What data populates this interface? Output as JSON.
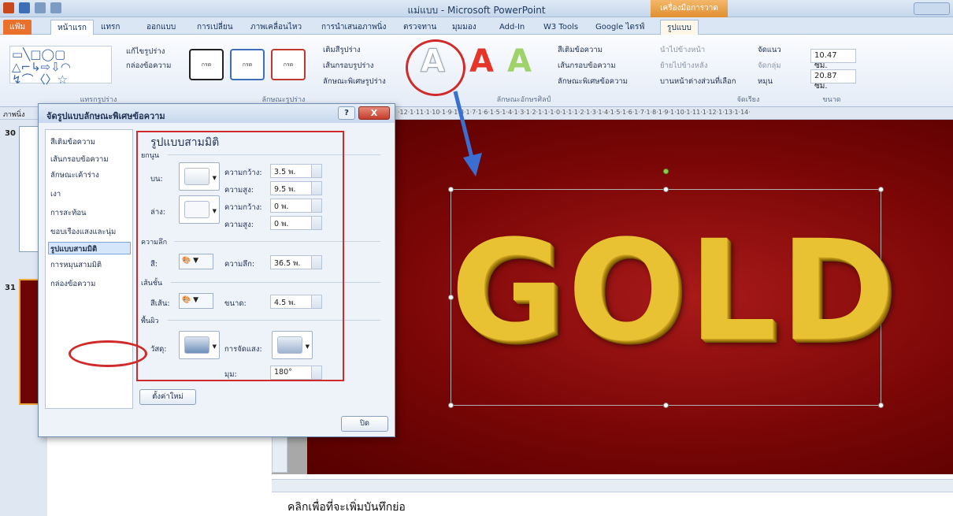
{
  "window": {
    "title": "แม่แบบ - Microsoft PowerPoint",
    "context_tab_group": "เครื่องมือการวาด"
  },
  "tabs": [
    "แฟ้ม",
    "หน้าแรก",
    "แทรก",
    "ออกแบบ",
    "การเปลี่ยน",
    "ภาพเคลื่อนไหว",
    "การนำเสนอภาพนิ่ง",
    "ตรวจทาน",
    "มุมมอง",
    "Add-In",
    "W3 Tools",
    "Google ไดรฟ์",
    "รูปแบบ"
  ],
  "ribbon": {
    "insert_shapes_label": "แทรกรูปร่าง",
    "edit_shape": "แก้ไขรูปร่าง",
    "textbox": "กล่องข้อความ",
    "shape_style_swatch": "กรด",
    "shape_fill": "เติมสีรูปร่าง",
    "shape_outline": "เส้นกรอบรูปร่าง",
    "shape_effects": "ลักษณะพิเศษรูปร่าง",
    "shape_styles_label": "ลักษณะรูปร่าง",
    "text_fill": "สีเติมข้อความ",
    "text_outline": "เส้นกรอบข้อความ",
    "text_effects": "ลักษณะพิเศษข้อความ",
    "wordart_label": "ลักษณะอักษรศิลป์",
    "bring_forward": "นำไปข้างหน้า",
    "send_backward": "ย้ายไปข้างหลัง",
    "selection_pane": "บานหน้าต่างส่วนที่เลือก",
    "align": "จัดแนว",
    "group": "จัดกลุ่ม",
    "rotate": "หมุน",
    "arrange_label": "จัดเรียง",
    "height": "10.47 ซม.",
    "width": "20.87 ซม.",
    "size_label": "ขนาด",
    "wordart_letter": "A"
  },
  "ruler": {
    "left_label": "ภาพนิ่ง",
    "marks": "·12·1·11·1·10·1·9·1·8·1·7·1·6·1·5·1·4·1·3·1·2·1·1·1·0·1·1·1·2·1·3·1·4·1·5·1·6·1·7·1·8·1·9·1·10·1·11·1·12·1·13·1·14·"
  },
  "slides": {
    "thumb1": "30",
    "thumb2": "31"
  },
  "slide": {
    "wordart_text": "GOLD"
  },
  "notes_placeholder": "คลิกเพื่อที่จะเพิ่มบันทึกย่อ",
  "dialog": {
    "title": "จัดรูปแบบลักษณะพิเศษข้อความ",
    "help": "?",
    "close_glyph": "X",
    "nav": [
      "สีเติมข้อความ",
      "เส้นกรอบข้อความ",
      "ลักษณะเค้าร่าง",
      "เงา",
      "การสะท้อน",
      "ขอบเรืองแสงและนุ่ม",
      "รูปแบบสามมิติ",
      "การหมุนสามมิติ",
      "กล่องข้อความ"
    ],
    "panel_title": "รูปแบบสามมิติ",
    "bevel": {
      "section": "ยกนูน",
      "top_label": "บน:",
      "bottom_label": "ล่าง:",
      "width_label": "ความกว้าง:",
      "height_label": "ความสูง:",
      "top_width": "3.5 พ.",
      "top_height": "9.5 พ.",
      "bottom_width": "0 พ.",
      "bottom_height": "0 พ."
    },
    "depth": {
      "section": "ความลึก",
      "color_label": "สี:",
      "depth_label": "ความลึก:",
      "depth": "36.5 พ."
    },
    "contour": {
      "section": "เส้นชั้น",
      "color_label": "สีเส้น:",
      "size_label": "ขนาด:",
      "size": "4.5 พ."
    },
    "surface": {
      "section": "พื้นผิว",
      "material_label": "วัสดุ:",
      "lighting_label": "การจัดแสง:",
      "angle_label": "มุม:",
      "angle": "180°"
    },
    "reset_button": "ตั้งค่าใหม่",
    "close_button": "ปิด"
  },
  "colors": {
    "accent_red": "#d12a2a",
    "arrow_blue": "#3a6fd1",
    "gold": "#e8c232",
    "file_tab": "#e9712b"
  }
}
